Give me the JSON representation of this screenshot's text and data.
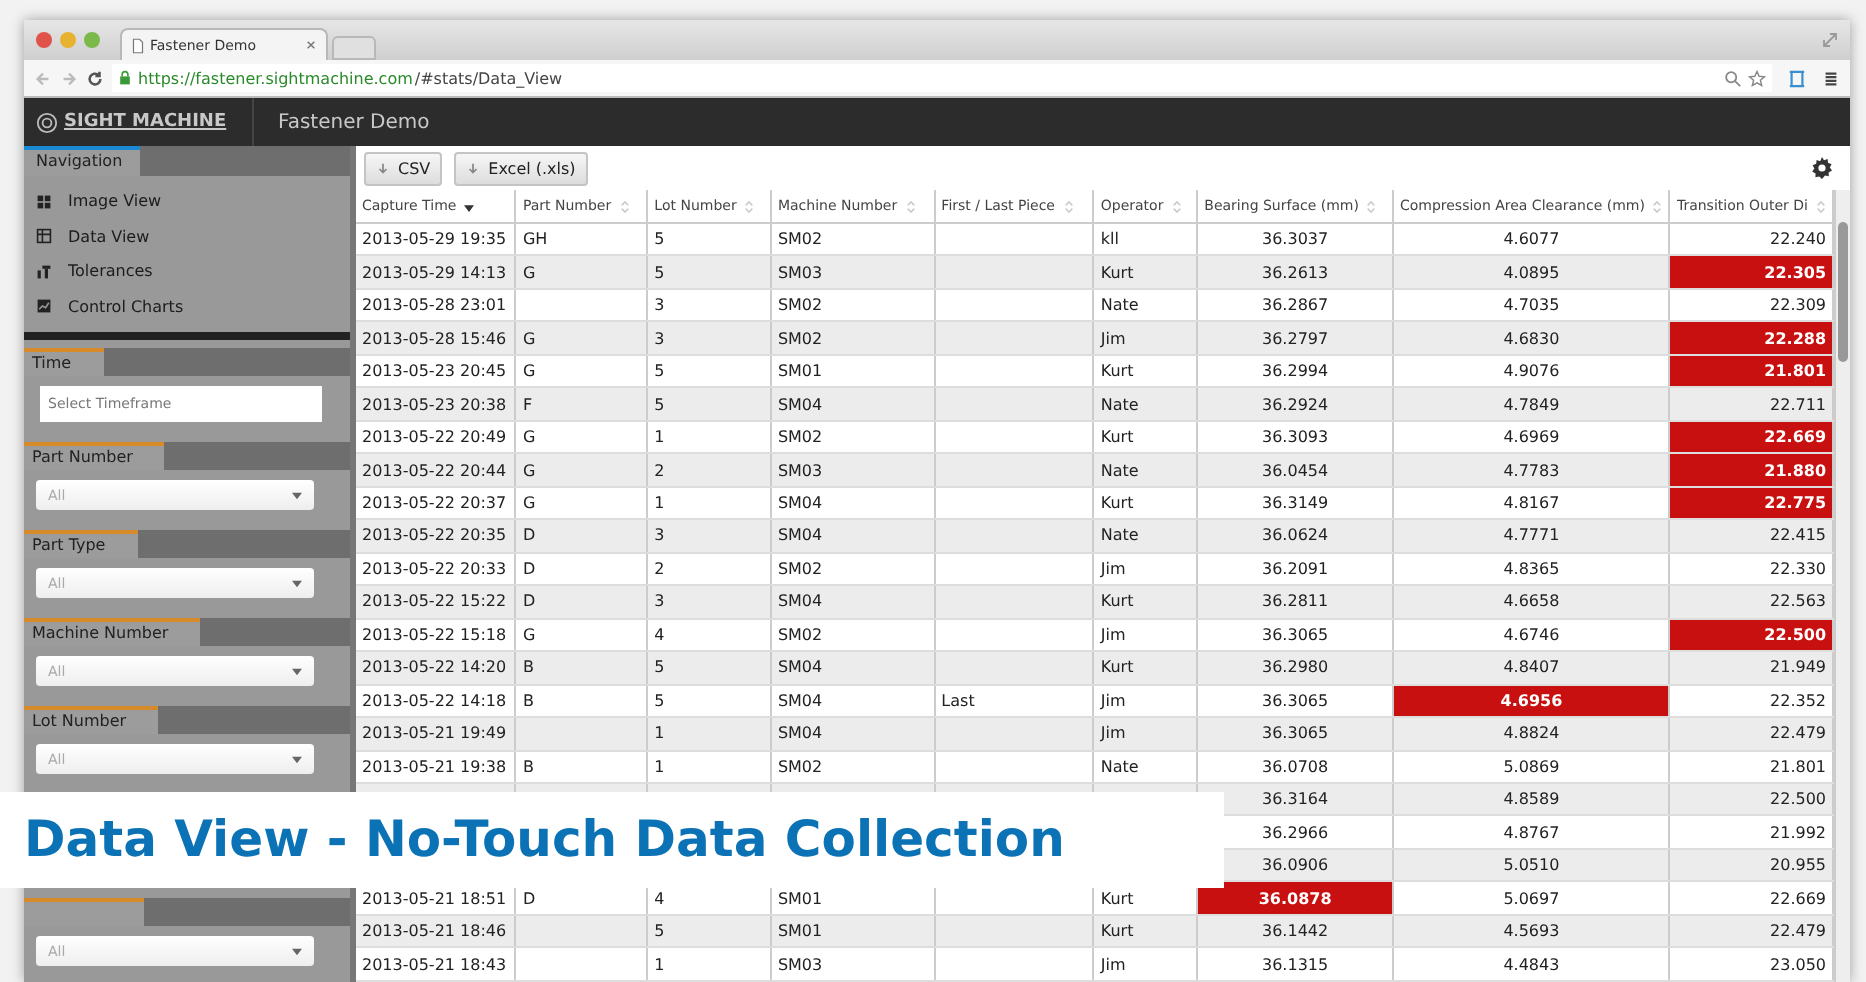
{
  "browser": {
    "tab_title": "Fastener Demo",
    "url_host": "https://fastener.sightmachine.com",
    "url_path": "/#stats/Data_View"
  },
  "app_header": {
    "logo": "SIGHT MACHINE",
    "title": "Fastener Demo"
  },
  "sidebar": {
    "tab": "Navigation",
    "nav_items": [
      {
        "label": "Image View",
        "kind": "grid"
      },
      {
        "label": "Data View",
        "kind": "table"
      },
      {
        "label": "Tolerances",
        "kind": "bars"
      },
      {
        "label": "Control Charts",
        "kind": "chart"
      }
    ],
    "filters": [
      {
        "label": "Time",
        "kind": "text",
        "placeholder": "Select Timeframe"
      },
      {
        "label": "Part Number",
        "kind": "select",
        "value": "All"
      },
      {
        "label": "Part Type",
        "kind": "select",
        "value": "All"
      },
      {
        "label": "Machine Number",
        "kind": "select",
        "value": "All"
      },
      {
        "label": "Lot Number",
        "kind": "select",
        "value": "All"
      },
      {
        "kind": "select",
        "value": "All"
      }
    ]
  },
  "toolbar": {
    "buttons": [
      "CSV",
      "Excel (.xls)"
    ]
  },
  "table": {
    "columns": [
      {
        "label": "Capture Time",
        "sorted": true
      },
      {
        "label": "Part Number",
        "sorted": false
      },
      {
        "label": "Lot Number",
        "sorted": false
      },
      {
        "label": "Machine Number",
        "sorted": false
      },
      {
        "label": "First / Last Piece",
        "sorted": false
      },
      {
        "label": "Operator",
        "sorted": false
      },
      {
        "label": "Bearing Surface (mm)",
        "sorted": false
      },
      {
        "label": "Compression Area Clearance (mm)",
        "sorted": false
      },
      {
        "label": "Transition Outer Di",
        "sorted": false
      }
    ],
    "rows": [
      {
        "cells": [
          "2013-05-29 19:35",
          "GH",
          "5",
          "SM02",
          "",
          "kll",
          "36.3037",
          "4.6077",
          "22.240"
        ],
        "flags": [
          false,
          false,
          false
        ]
      },
      {
        "cells": [
          "2013-05-29 14:13",
          "G",
          "5",
          "SM03",
          "",
          "Kurt",
          "36.2613",
          "4.0895",
          "22.305"
        ],
        "flags": [
          false,
          false,
          true
        ]
      },
      {
        "cells": [
          "2013-05-28 23:01",
          "",
          "3",
          "SM02",
          "",
          "Nate",
          "36.2867",
          "4.7035",
          "22.309"
        ],
        "flags": [
          false,
          false,
          false
        ]
      },
      {
        "cells": [
          "2013-05-28 15:46",
          "G",
          "3",
          "SM02",
          "",
          "Jim",
          "36.2797",
          "4.6830",
          "22.288"
        ],
        "flags": [
          false,
          false,
          true
        ]
      },
      {
        "cells": [
          "2013-05-23 20:45",
          "G",
          "5",
          "SM01",
          "",
          "Kurt",
          "36.2994",
          "4.9076",
          "21.801"
        ],
        "flags": [
          false,
          false,
          true
        ]
      },
      {
        "cells": [
          "2013-05-23 20:38",
          "F",
          "5",
          "SM04",
          "",
          "Nate",
          "36.2924",
          "4.7849",
          "22.711"
        ],
        "flags": [
          false,
          false,
          false
        ]
      },
      {
        "cells": [
          "2013-05-22 20:49",
          "G",
          "1",
          "SM02",
          "",
          "Kurt",
          "36.3093",
          "4.6969",
          "22.669"
        ],
        "flags": [
          false,
          false,
          true
        ]
      },
      {
        "cells": [
          "2013-05-22 20:44",
          "G",
          "2",
          "SM03",
          "",
          "Nate",
          "36.0454",
          "4.7783",
          "21.880"
        ],
        "flags": [
          false,
          false,
          true
        ]
      },
      {
        "cells": [
          "2013-05-22 20:37",
          "G",
          "1",
          "SM04",
          "",
          "Kurt",
          "36.3149",
          "4.8167",
          "22.775"
        ],
        "flags": [
          false,
          false,
          true
        ]
      },
      {
        "cells": [
          "2013-05-22 20:35",
          "D",
          "3",
          "SM04",
          "",
          "Nate",
          "36.0624",
          "4.7771",
          "22.415"
        ],
        "flags": [
          false,
          false,
          false
        ]
      },
      {
        "cells": [
          "2013-05-22 20:33",
          "D",
          "2",
          "SM02",
          "",
          "Jim",
          "36.2091",
          "4.8365",
          "22.330"
        ],
        "flags": [
          false,
          false,
          false
        ]
      },
      {
        "cells": [
          "2013-05-22 15:22",
          "D",
          "3",
          "SM04",
          "",
          "Kurt",
          "36.2811",
          "4.6658",
          "22.563"
        ],
        "flags": [
          false,
          false,
          false
        ]
      },
      {
        "cells": [
          "2013-05-22 15:18",
          "G",
          "4",
          "SM02",
          "",
          "Jim",
          "36.3065",
          "4.6746",
          "22.500"
        ],
        "flags": [
          false,
          false,
          true
        ]
      },
      {
        "cells": [
          "2013-05-22 14:20",
          "B",
          "5",
          "SM04",
          "",
          "Kurt",
          "36.2980",
          "4.8407",
          "21.949"
        ],
        "flags": [
          false,
          false,
          false
        ]
      },
      {
        "cells": [
          "2013-05-22 14:18",
          "B",
          "5",
          "SM04",
          "Last",
          "Jim",
          "36.3065",
          "4.6956",
          "22.352"
        ],
        "flags": [
          false,
          true,
          false
        ]
      },
      {
        "cells": [
          "2013-05-21 19:49",
          "",
          "1",
          "SM04",
          "",
          "Jim",
          "36.3065",
          "4.8824",
          "22.479"
        ],
        "flags": [
          false,
          false,
          false
        ]
      },
      {
        "cells": [
          "2013-05-21 19:38",
          "B",
          "1",
          "SM02",
          "",
          "Nate",
          "36.0708",
          "5.0869",
          "21.801"
        ],
        "flags": [
          false,
          false,
          false
        ]
      },
      {
        "cells": [
          "",
          "",
          "",
          "",
          "",
          "",
          "36.3164",
          "4.8589",
          "22.500"
        ],
        "flags": [
          false,
          false,
          false
        ]
      },
      {
        "cells": [
          "",
          "",
          "",
          "",
          "",
          "",
          "36.2966",
          "4.8767",
          "21.992"
        ],
        "flags": [
          false,
          false,
          false
        ]
      },
      {
        "cells": [
          "",
          "",
          "",
          "",
          "",
          "",
          "36.0906",
          "5.0510",
          "20.955"
        ],
        "flags": [
          false,
          false,
          false
        ]
      },
      {
        "cells": [
          "2013-05-21 18:51",
          "D",
          "4",
          "SM01",
          "",
          "Kurt",
          "36.0878",
          "5.0697",
          "22.669"
        ],
        "flags": [
          true,
          false,
          false
        ]
      },
      {
        "cells": [
          "2013-05-21 18:46",
          "",
          "5",
          "SM01",
          "",
          "Kurt",
          "36.1442",
          "4.5693",
          "22.479"
        ],
        "flags": [
          false,
          false,
          false
        ]
      },
      {
        "cells": [
          "2013-05-21 18:43",
          "",
          "1",
          "SM03",
          "",
          "Jim",
          "36.1315",
          "4.4843",
          "23.050"
        ],
        "flags": [
          false,
          false,
          false
        ]
      }
    ]
  },
  "caption": "Data View - No-Touch Data Collection"
}
